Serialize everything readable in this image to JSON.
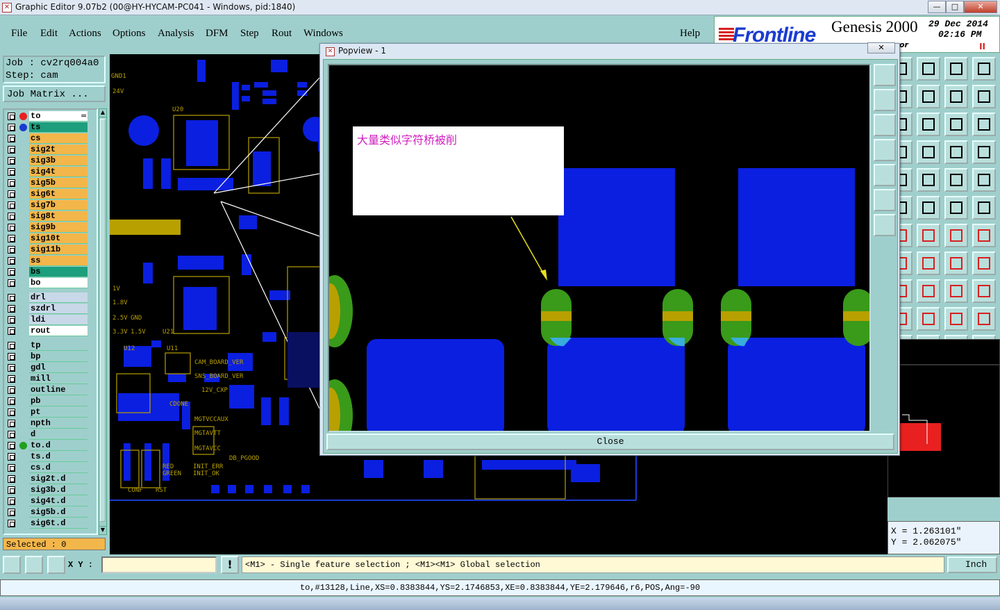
{
  "window": {
    "title": "Graphic Editor 9.07b2 (00@HY-HYCAM-PC041 - Windows, pid:1840)",
    "min_label": "—",
    "max_label": "□",
    "close_label": "✕"
  },
  "menu": [
    "File",
    "Edit",
    "Actions",
    "Options",
    "Analysis",
    "DFM",
    "Step",
    "Rout",
    "Windows"
  ],
  "help_label": "Help",
  "brand": {
    "logo": "Frontline",
    "product": "Genesis 2000",
    "date": "29 Dec 2014",
    "time": "02:16 PM",
    "pause": "II",
    "subtext": "or"
  },
  "job": {
    "job_line": "Job : cv2rq004a0",
    "step_line": "Step: cam",
    "matrix_button": "Job Matrix ..."
  },
  "layers": [
    {
      "name": "to",
      "color": "#ffffff",
      "dot": "#e82020",
      "marker": "="
    },
    {
      "name": "ts",
      "color": "#1d9e7c",
      "dot": "#1a3cd1"
    },
    {
      "name": "cs",
      "color": "#f3b64a"
    },
    {
      "name": "sig2t",
      "color": "#f3b64a"
    },
    {
      "name": "sig3b",
      "color": "#f3b64a"
    },
    {
      "name": "sig4t",
      "color": "#f3b64a"
    },
    {
      "name": "sig5b",
      "color": "#f3b64a"
    },
    {
      "name": "sig6t",
      "color": "#f3b64a"
    },
    {
      "name": "sig7b",
      "color": "#f3b64a"
    },
    {
      "name": "sig8t",
      "color": "#f3b64a"
    },
    {
      "name": "sig9b",
      "color": "#f3b64a"
    },
    {
      "name": "sig10t",
      "color": "#f3b64a"
    },
    {
      "name": "sig11b",
      "color": "#f3b64a"
    },
    {
      "name": "ss",
      "color": "#f3b64a"
    },
    {
      "name": "bs",
      "color": "#1d9e7c"
    },
    {
      "name": "bo",
      "color": "#ffffff"
    },
    {
      "name": "drl",
      "color": "#c8d8e8"
    },
    {
      "name": "szdrl",
      "color": "#c8d8e8"
    },
    {
      "name": "ldi",
      "color": "#c8d8e8"
    },
    {
      "name": "rout",
      "color": "#ffffff"
    },
    {
      "name": "tp",
      "color": "#9fcfcc"
    },
    {
      "name": "bp",
      "color": "#9fcfcc"
    },
    {
      "name": "gdl",
      "color": "#9fcfcc"
    },
    {
      "name": "mill",
      "color": "#9fcfcc"
    },
    {
      "name": "outline",
      "color": "#9fcfcc"
    },
    {
      "name": "pb",
      "color": "#9fcfcc"
    },
    {
      "name": "pt",
      "color": "#9fcfcc"
    },
    {
      "name": "npth",
      "color": "#9fcfcc"
    },
    {
      "name": "d",
      "color": "#9fcfcc"
    },
    {
      "name": "to.d",
      "color": "#9fcfcc",
      "dot": "#1fa020"
    },
    {
      "name": "ts.d",
      "color": "#9fcfcc"
    },
    {
      "name": "cs.d",
      "color": "#9fcfcc"
    },
    {
      "name": "sig2t.d",
      "color": "#9fcfcc"
    },
    {
      "name": "sig3b.d",
      "color": "#9fcfcc"
    },
    {
      "name": "sig4t.d",
      "color": "#9fcfcc"
    },
    {
      "name": "sig5b.d",
      "color": "#9fcfcc"
    },
    {
      "name": "sig6t.d",
      "color": "#9fcfcc"
    }
  ],
  "selected_text": "Selected : 0",
  "popup": {
    "title": "Popview - 1",
    "close_label": "Close",
    "annotation": "大量类似字符桥被削"
  },
  "coords": {
    "x": "X = 1.263101\"",
    "y": "Y = 2.062075\""
  },
  "status": {
    "xy_label": "X Y :",
    "xy_value": "",
    "message": "<M1> - Single feature selection ; <M1><M1> Global selection",
    "unit": "Inch"
  },
  "info": "to,#13128,Line,XS=0.8383844,YS=2.1746853,XE=0.8383844,YE=2.179646,r6,POS,Ang=-90",
  "board_labels": {
    "u20": "U20",
    "u21": "U21",
    "u12": "U12",
    "u11": "U11",
    "cam_board_ver": "CAM_BOARD_VER",
    "sns_board_ver": "SNS_BOARD_VER",
    "v12_cxp": "12V_CXP",
    "cdone": "CDONE",
    "mgtvccaux": "MGTVCCAUX",
    "mgtavtt": "MGTAVTT",
    "mgtavcc": "MGTAVCC",
    "init_err": "INIT_ERR",
    "init_ok": "INIT_OK",
    "db_pgood": "DB_PGOOD",
    "conf": "CONF",
    "rst": "RST",
    "gnd1": "GND1",
    "v24": "24V",
    "v18": "1.8V",
    "v25": "2.5V",
    "gnd": "GND",
    "v33": "3.3V",
    "v15": "1.5V",
    "v1": "1V",
    "red": "RED",
    "green": "GREEN"
  },
  "colors": {
    "pad_blue": "#0b1fe0",
    "silk_gold": "#b8a000",
    "ts_green": "#3a9a1a",
    "panel_bg": "#9fcfcc",
    "accent_orange": "#f5a33b"
  }
}
